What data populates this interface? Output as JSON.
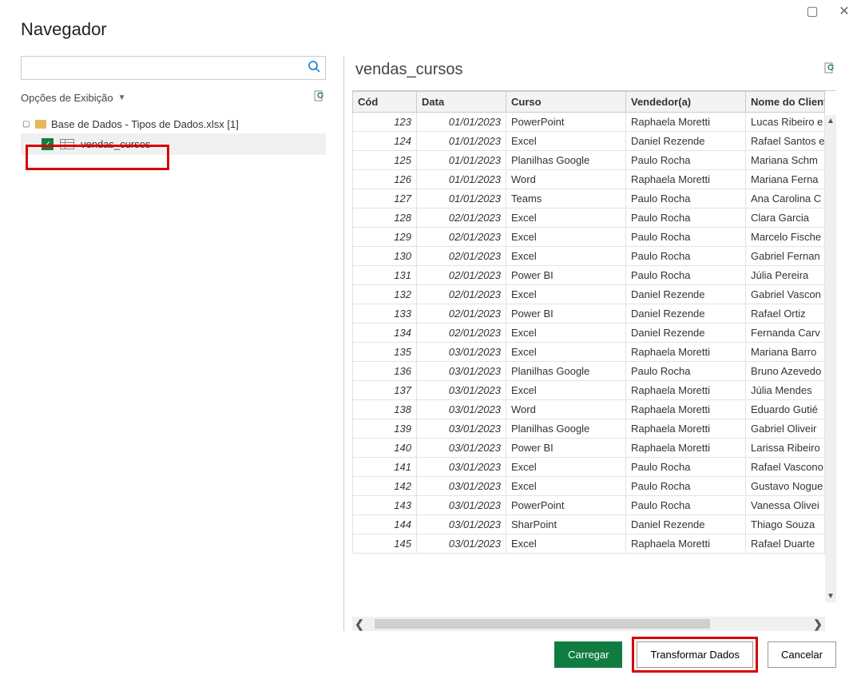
{
  "window": {
    "title": "Navegador"
  },
  "left": {
    "search_placeholder": "",
    "options_label": "Opções de Exibição",
    "file_label": "Base de Dados - Tipos de Dados.xlsx [1]",
    "table_label": "vendas_cursos"
  },
  "preview": {
    "title": "vendas_cursos",
    "columns": [
      "Cód",
      "Data",
      "Curso",
      "Vendedor(a)",
      "Nome do Cliente"
    ],
    "rows": [
      {
        "cod": "123",
        "data": "01/01/2023",
        "curso": "PowerPoint",
        "vend": "Raphaela Moretti",
        "cliente": "Lucas Ribeiro e"
      },
      {
        "cod": "124",
        "data": "01/01/2023",
        "curso": "Excel",
        "vend": "Daniel Rezende",
        "cliente": "Rafael Santos e"
      },
      {
        "cod": "125",
        "data": "01/01/2023",
        "curso": "Planilhas Google",
        "vend": "Paulo Rocha",
        "cliente": "Mariana Schm"
      },
      {
        "cod": "126",
        "data": "01/01/2023",
        "curso": "Word",
        "vend": "Raphaela Moretti",
        "cliente": "Mariana Ferna"
      },
      {
        "cod": "127",
        "data": "01/01/2023",
        "curso": "Teams",
        "vend": "Paulo Rocha",
        "cliente": "Ana Carolina C"
      },
      {
        "cod": "128",
        "data": "02/01/2023",
        "curso": "Excel",
        "vend": "Paulo Rocha",
        "cliente": "Clara Garcia"
      },
      {
        "cod": "129",
        "data": "02/01/2023",
        "curso": "Excel",
        "vend": "Paulo Rocha",
        "cliente": "Marcelo Fische"
      },
      {
        "cod": "130",
        "data": "02/01/2023",
        "curso": "Excel",
        "vend": "Paulo Rocha",
        "cliente": "Gabriel Fernan"
      },
      {
        "cod": "131",
        "data": "02/01/2023",
        "curso": "Power BI",
        "vend": "Paulo Rocha",
        "cliente": "Júlia Pereira"
      },
      {
        "cod": "132",
        "data": "02/01/2023",
        "curso": "Excel",
        "vend": "Daniel Rezende",
        "cliente": "Gabriel Vascon"
      },
      {
        "cod": "133",
        "data": "02/01/2023",
        "curso": "Power BI",
        "vend": "Daniel Rezende",
        "cliente": "Rafael Ortiz"
      },
      {
        "cod": "134",
        "data": "02/01/2023",
        "curso": "Excel",
        "vend": "Daniel Rezende",
        "cliente": "Fernanda Carv"
      },
      {
        "cod": "135",
        "data": "03/01/2023",
        "curso": "Excel",
        "vend": "Raphaela Moretti",
        "cliente": "Mariana Barro"
      },
      {
        "cod": "136",
        "data": "03/01/2023",
        "curso": "Planilhas Google",
        "vend": "Paulo Rocha",
        "cliente": "Bruno Azevedo"
      },
      {
        "cod": "137",
        "data": "03/01/2023",
        "curso": "Excel",
        "vend": "Raphaela Moretti",
        "cliente": "Júlia Mendes"
      },
      {
        "cod": "138",
        "data": "03/01/2023",
        "curso": "Word",
        "vend": "Raphaela Moretti",
        "cliente": "Eduardo Gutié"
      },
      {
        "cod": "139",
        "data": "03/01/2023",
        "curso": "Planilhas Google",
        "vend": "Raphaela Moretti",
        "cliente": "Gabriel Oliveir"
      },
      {
        "cod": "140",
        "data": "03/01/2023",
        "curso": "Power BI",
        "vend": "Raphaela Moretti",
        "cliente": "Larissa Ribeiro"
      },
      {
        "cod": "141",
        "data": "03/01/2023",
        "curso": "Excel",
        "vend": "Paulo Rocha",
        "cliente": "Rafael Vascono"
      },
      {
        "cod": "142",
        "data": "03/01/2023",
        "curso": "Excel",
        "vend": "Paulo Rocha",
        "cliente": "Gustavo Nogue"
      },
      {
        "cod": "143",
        "data": "03/01/2023",
        "curso": "PowerPoint",
        "vend": "Paulo Rocha",
        "cliente": "Vanessa Olivei"
      },
      {
        "cod": "144",
        "data": "03/01/2023",
        "curso": "SharPoint",
        "vend": "Daniel Rezende",
        "cliente": "Thiago Souza"
      },
      {
        "cod": "145",
        "data": "03/01/2023",
        "curso": "Excel",
        "vend": "Raphaela Moretti",
        "cliente": "Rafael Duarte"
      }
    ]
  },
  "buttons": {
    "load": "Carregar",
    "transform": "Transformar Dados",
    "cancel": "Cancelar"
  }
}
